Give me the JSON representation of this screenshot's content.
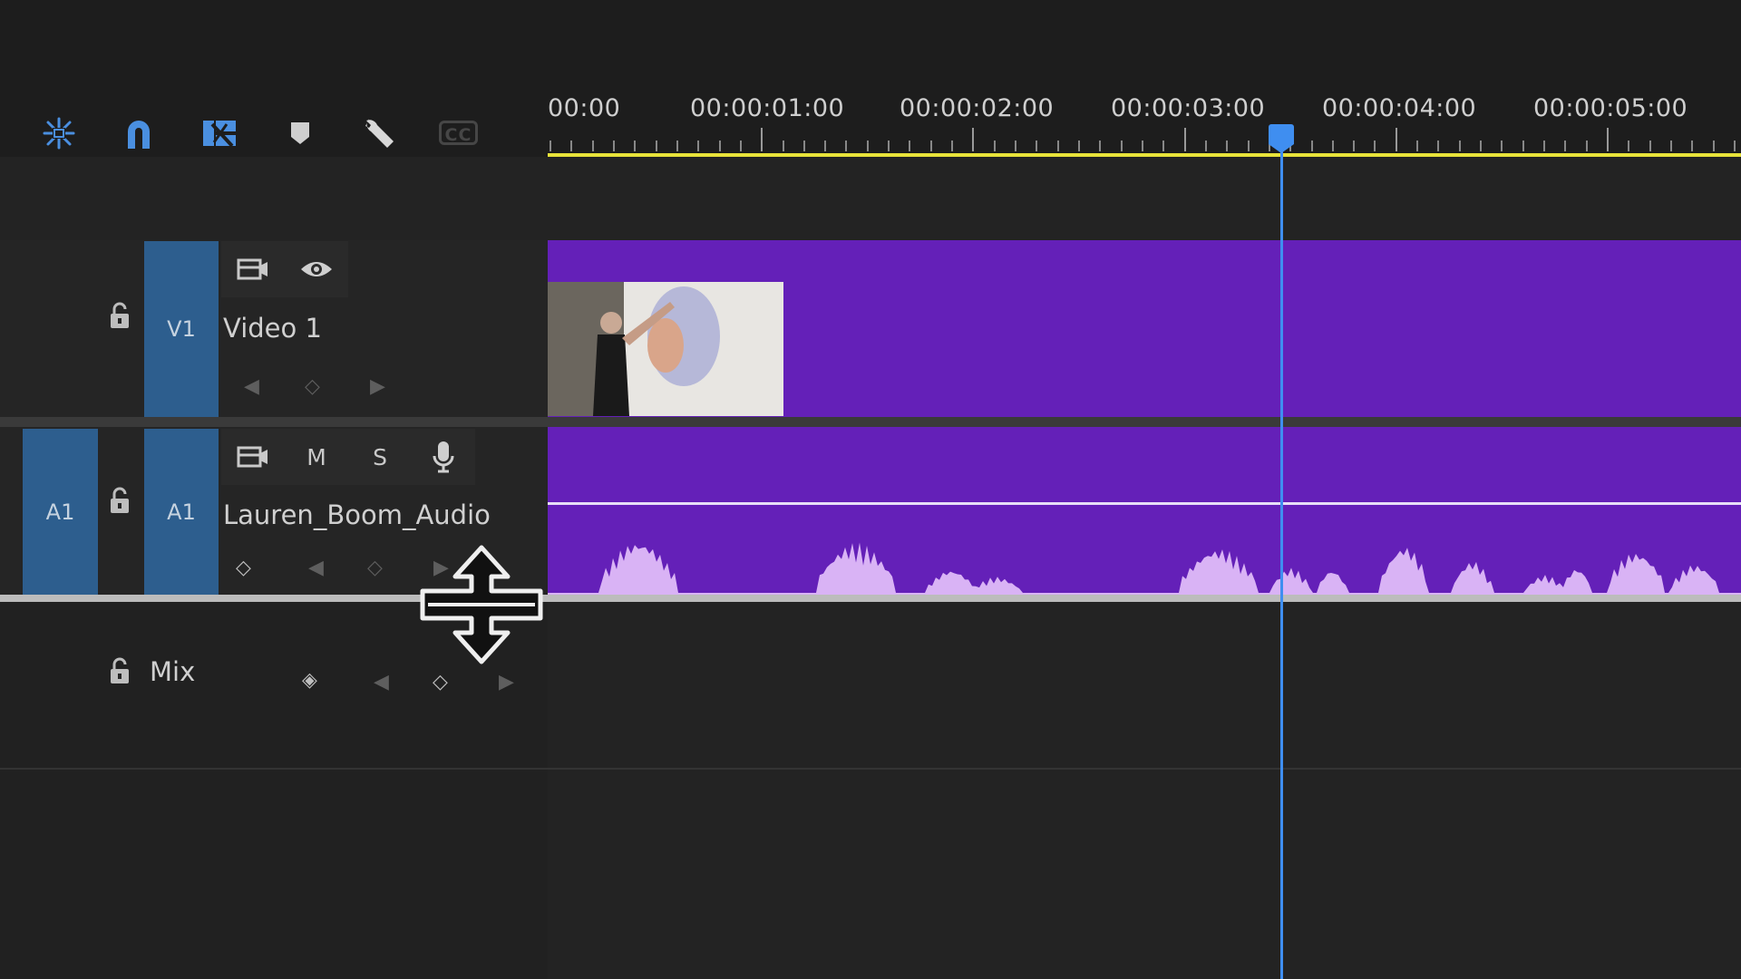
{
  "toolbar": {
    "icons": [
      "snap-nested-icon",
      "magnet-icon",
      "linked-selection-icon",
      "marker-icon",
      "wrench-icon"
    ],
    "cc_label": "CC"
  },
  "ruler": {
    "timecodes": [
      "00:00",
      "00:00:01:00",
      "00:00:02:00",
      "00:00:03:00",
      "00:00:04:00",
      "00:00:05:00"
    ],
    "playhead_seconds": 3.5
  },
  "tracks": {
    "v1": {
      "tag": "V1",
      "name": "Video 1"
    },
    "a1": {
      "source_tag": "A1",
      "tag": "A1",
      "name": "Lauren_Boom_Audio",
      "mute": "M",
      "solo": "S"
    },
    "mix": {
      "name": "Mix"
    }
  },
  "colors": {
    "clip": "#6420b8",
    "waveform": "#d9b3f5",
    "track_tag": "#2d5e8e",
    "playhead": "#3f8ef0",
    "work_area": "#e8e33a"
  }
}
